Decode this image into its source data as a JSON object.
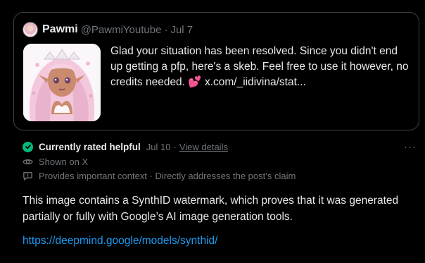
{
  "quoted_post": {
    "author_name": "Pawmi",
    "author_handle": "@PawmiYoutube",
    "separator": "·",
    "date": "Jul 7",
    "text": "Glad your situation has been resolved. Since you didn't end up getting a pfp, here's a skeb. Feel free to use it however, no credits needed.",
    "emoji": "💕",
    "link_text": "x.com/_iidivina/stat..."
  },
  "community_note": {
    "status_label": "Currently rated helpful",
    "status_date": "Jul 10",
    "separator": "·",
    "view_details": "View details",
    "more_label": "···",
    "shown_on": "Shown on X",
    "context": "Provides important context · Directly addresses the post’s claim",
    "body": "This image contains a SynthID watermark, which proves that it was generated partially or fully with Google’s AI image generation tools.",
    "link": "https://deepmind.google/models/synthid/"
  },
  "colors": {
    "background": "#000000",
    "text": "#e7e9ea",
    "muted": "#71767b",
    "link": "#1d9bf0",
    "helpful_green": "#00ba7c"
  }
}
